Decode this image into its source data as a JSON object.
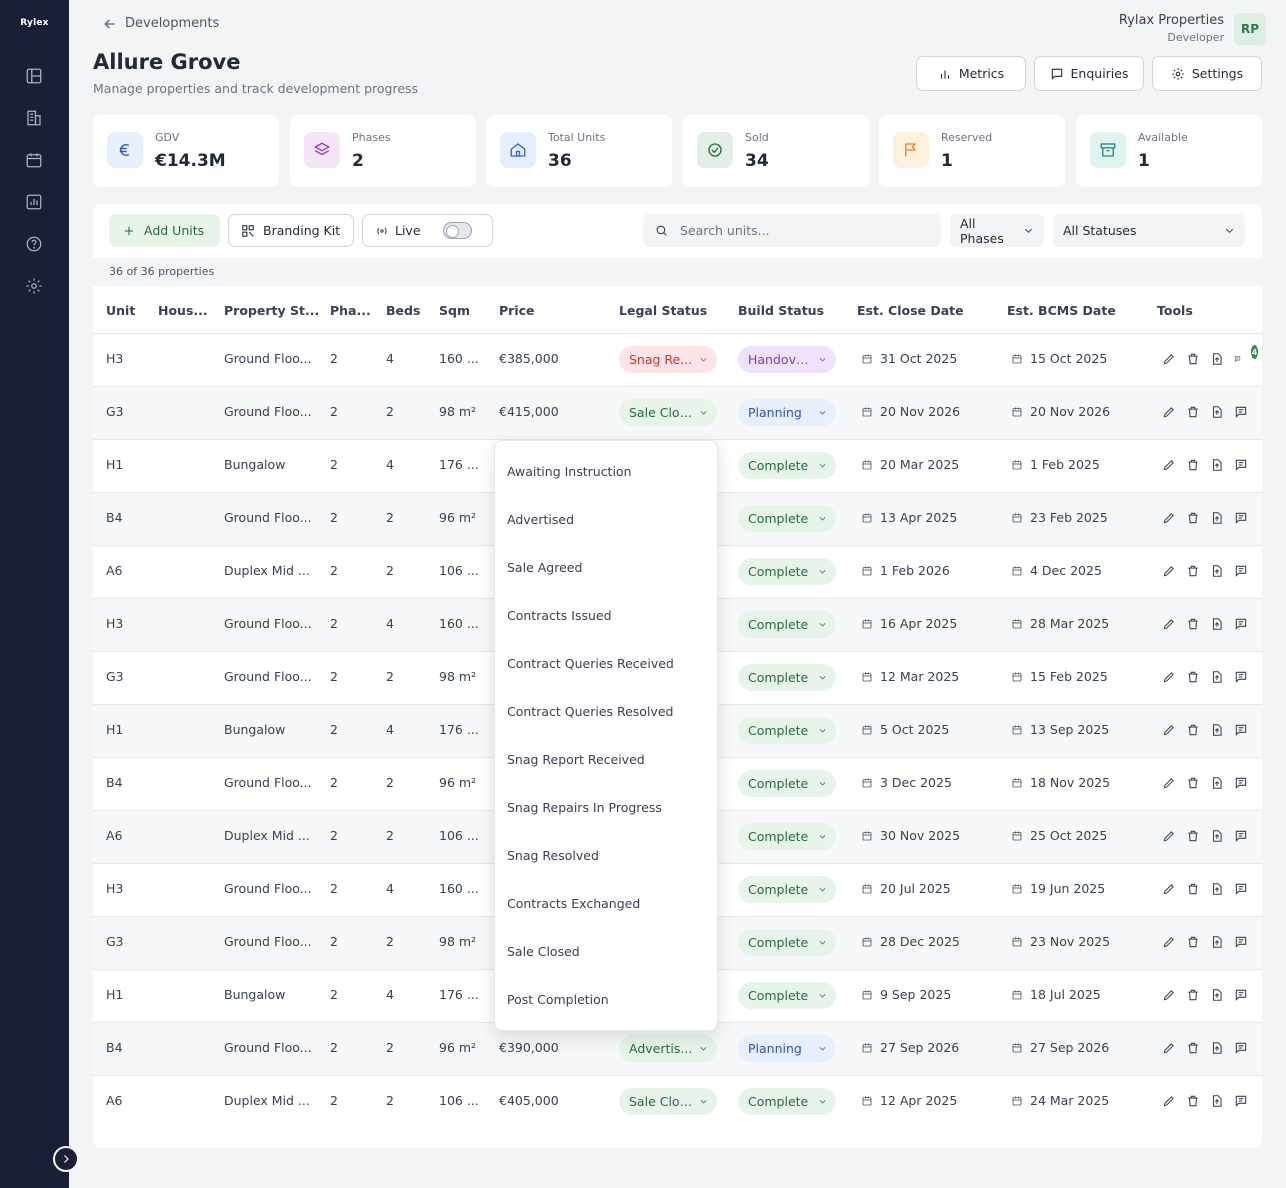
{
  "app": {
    "logo": "Rylex"
  },
  "header": {
    "back_label": "Developments",
    "title": "Allure Grove",
    "subtitle": "Manage properties and track development progress",
    "user_name": "Rylax Properties",
    "user_role": "Developer",
    "avatar_initials": "RP",
    "buttons": {
      "metrics": "Metrics",
      "enquiries": "Enquiries",
      "settings": "Settings"
    }
  },
  "stats": [
    {
      "label": "GDV",
      "value": "€14.3M",
      "icon": "euro-icon",
      "color": "#2c54b3",
      "bg": "#e8effd"
    },
    {
      "label": "Phases",
      "value": "2",
      "icon": "layers-icon",
      "color": "#9b3fb6",
      "bg": "#f6e5f7"
    },
    {
      "label": "Total Units",
      "value": "36",
      "icon": "home-icon",
      "color": "#2c6bd3",
      "bg": "#e5effc"
    },
    {
      "label": "Sold",
      "value": "34",
      "icon": "check-badge-icon",
      "color": "#256b3f",
      "bg": "#e3efe6"
    },
    {
      "label": "Reserved",
      "value": "1",
      "icon": "flag-icon",
      "color": "#e08a1e",
      "bg": "#fdf0dd"
    },
    {
      "label": "Available",
      "value": "1",
      "icon": "archive-icon",
      "color": "#1f8a8a",
      "bg": "#dff3f1"
    }
  ],
  "toolbar": {
    "add_units": "Add Units",
    "branding_kit": "Branding Kit",
    "live": "Live",
    "search_placeholder": "Search units...",
    "phases_filter": "All Phases",
    "status_filter": "All Statuses",
    "count": "36 of 36 properties"
  },
  "table": {
    "columns": [
      "Unit",
      "Hous...",
      "Property St...",
      "Pha...",
      "Beds",
      "Sqm",
      "Price",
      "Legal Status",
      "Build Status",
      "Est. Close Date",
      "Est. BCMS Date",
      "Tools"
    ],
    "rows": [
      {
        "unit": "H3",
        "house": "",
        "type": "Ground Floo...",
        "phase": "2",
        "beds": "4",
        "sqm": "160 ...",
        "price": "€385,000",
        "legal": "Snag Re...",
        "legal_style": "red",
        "build": "Handove...",
        "build_style": "purple",
        "close": "31 Oct 2025",
        "bcms": "15 Oct 2025",
        "comments": "4"
      },
      {
        "unit": "G3",
        "house": "",
        "type": "Ground Floo...",
        "phase": "2",
        "beds": "2",
        "sqm": "98 m²",
        "price": "€415,000",
        "legal": "Sale Clos...",
        "legal_style": "green",
        "build": "Planning",
        "build_style": "blue",
        "close": "20 Nov 2026",
        "bcms": "20 Nov 2026",
        "comments": ""
      },
      {
        "unit": "H1",
        "house": "",
        "type": "Bungalow",
        "phase": "2",
        "beds": "4",
        "sqm": "176 ...",
        "price": "",
        "legal": "",
        "legal_style": "",
        "build": "Complete",
        "build_style": "green",
        "close": "20 Mar 2025",
        "bcms": "1 Feb 2025",
        "comments": ""
      },
      {
        "unit": "B4",
        "house": "",
        "type": "Ground Floo...",
        "phase": "2",
        "beds": "2",
        "sqm": "96 m²",
        "price": "",
        "legal": "",
        "legal_style": "",
        "build": "Complete",
        "build_style": "green",
        "close": "13 Apr 2025",
        "bcms": "23 Feb 2025",
        "comments": ""
      },
      {
        "unit": "A6",
        "house": "",
        "type": "Duplex Mid ...",
        "phase": "2",
        "beds": "2",
        "sqm": "106 ...",
        "price": "",
        "legal": "",
        "legal_style": "",
        "build": "Complete",
        "build_style": "green",
        "close": "1 Feb 2026",
        "bcms": "4 Dec 2025",
        "comments": ""
      },
      {
        "unit": "H3",
        "house": "",
        "type": "Ground Floo...",
        "phase": "2",
        "beds": "4",
        "sqm": "160 ...",
        "price": "",
        "legal": "",
        "legal_style": "",
        "build": "Complete",
        "build_style": "green",
        "close": "16 Apr 2025",
        "bcms": "28 Mar 2025",
        "comments": ""
      },
      {
        "unit": "G3",
        "house": "",
        "type": "Ground Floo...",
        "phase": "2",
        "beds": "2",
        "sqm": "98 m²",
        "price": "",
        "legal": "",
        "legal_style": "",
        "build": "Complete",
        "build_style": "green",
        "close": "12 Mar 2025",
        "bcms": "15 Feb 2025",
        "comments": ""
      },
      {
        "unit": "H1",
        "house": "",
        "type": "Bungalow",
        "phase": "2",
        "beds": "4",
        "sqm": "176 ...",
        "price": "",
        "legal": "",
        "legal_style": "",
        "build": "Complete",
        "build_style": "green",
        "close": "5 Oct 2025",
        "bcms": "13 Sep 2025",
        "comments": ""
      },
      {
        "unit": "B4",
        "house": "",
        "type": "Ground Floo...",
        "phase": "2",
        "beds": "2",
        "sqm": "96 m²",
        "price": "",
        "legal": "",
        "legal_style": "",
        "build": "Complete",
        "build_style": "green",
        "close": "3 Dec 2025",
        "bcms": "18 Nov 2025",
        "comments": ""
      },
      {
        "unit": "A6",
        "house": "",
        "type": "Duplex Mid ...",
        "phase": "2",
        "beds": "2",
        "sqm": "106 ...",
        "price": "",
        "legal": "",
        "legal_style": "",
        "build": "Complete",
        "build_style": "green",
        "close": "30 Nov 2025",
        "bcms": "25 Oct 2025",
        "comments": ""
      },
      {
        "unit": "H3",
        "house": "",
        "type": "Ground Floo...",
        "phase": "2",
        "beds": "4",
        "sqm": "160 ...",
        "price": "",
        "legal": "",
        "legal_style": "",
        "build": "Complete",
        "build_style": "green",
        "close": "20 Jul 2025",
        "bcms": "19 Jun 2025",
        "comments": ""
      },
      {
        "unit": "G3",
        "house": "",
        "type": "Ground Floo...",
        "phase": "2",
        "beds": "2",
        "sqm": "98 m²",
        "price": "",
        "legal": "",
        "legal_style": "",
        "build": "Complete",
        "build_style": "green",
        "close": "28 Dec 2025",
        "bcms": "23 Nov 2025",
        "comments": ""
      },
      {
        "unit": "H1",
        "house": "",
        "type": "Bungalow",
        "phase": "2",
        "beds": "4",
        "sqm": "176 ...",
        "price": "",
        "legal": "",
        "legal_style": "",
        "build": "Complete",
        "build_style": "green",
        "close": "9 Sep 2025",
        "bcms": "18 Jul 2025",
        "comments": ""
      },
      {
        "unit": "B4",
        "house": "",
        "type": "Ground Floo...",
        "phase": "2",
        "beds": "2",
        "sqm": "96 m²",
        "price": "€390,000",
        "legal": "Advertis...",
        "legal_style": "green",
        "build": "Planning",
        "build_style": "blue",
        "close": "27 Sep 2026",
        "bcms": "27 Sep 2026",
        "comments": ""
      },
      {
        "unit": "A6",
        "house": "",
        "type": "Duplex Mid ...",
        "phase": "2",
        "beds": "2",
        "sqm": "106 ...",
        "price": "€405,000",
        "legal": "Sale Clos...",
        "legal_style": "green",
        "build": "Complete",
        "build_style": "green",
        "close": "12 Apr 2025",
        "bcms": "24 Mar 2025",
        "comments": ""
      }
    ]
  },
  "legal_status_menu": [
    "Awaiting Instruction",
    "Advertised",
    "Sale Agreed",
    "Contracts Issued",
    "Contract Queries Received",
    "Contract Queries Resolved",
    "Snag Report Received",
    "Snag Repairs In Progress",
    "Snag Resolved",
    "Contracts Exchanged",
    "Sale Closed",
    "Post Completion"
  ]
}
